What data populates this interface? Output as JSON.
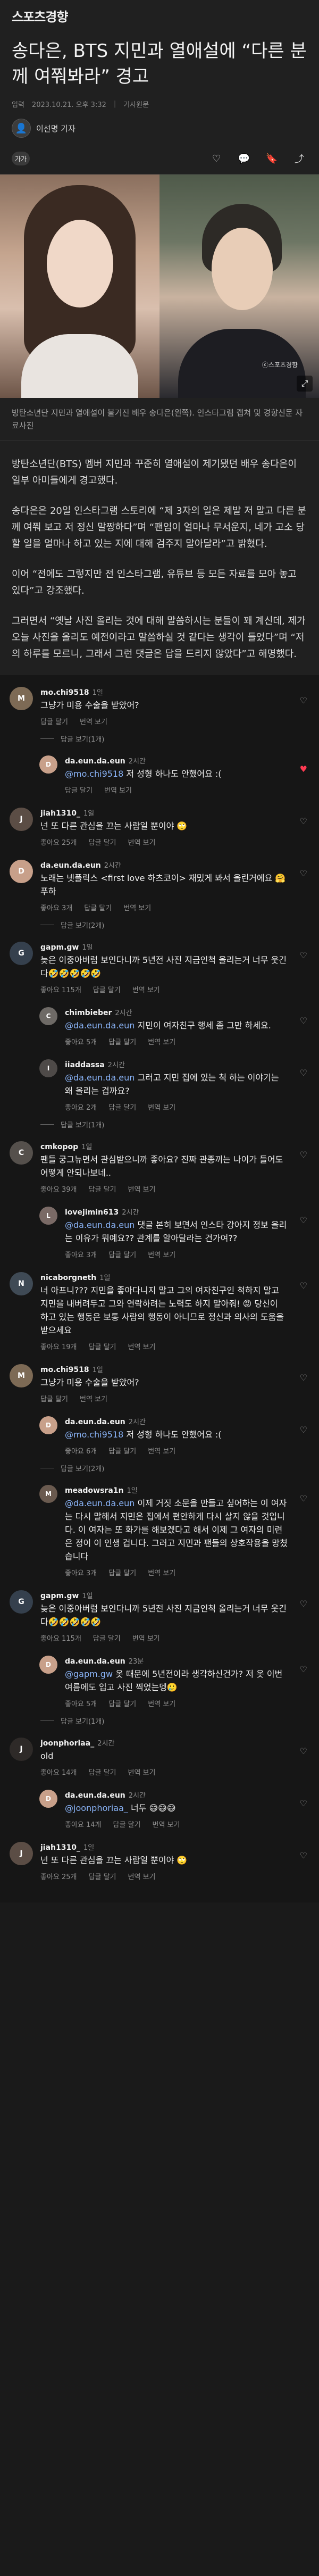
{
  "site": {
    "logo": "스포츠경향"
  },
  "article": {
    "headline": "송다은, BTS 지민과 열애설에 “다른 분께 여쭤봐라” 경고",
    "date_label": "입력",
    "date": "2023.10.21. 오후 3:32",
    "source_link": "기사원문",
    "reporter": "이선명 기자",
    "font_button": "가가",
    "photo_watermark": "ⓒ스포츠경향",
    "caption": "방탄소년단 지민과 열애설이 불거진 배우 송다은(왼쪽). 인스타그램 캡쳐 및 경향신문 자료사진",
    "paragraphs": [
      "방탄소년단(BTS) 멤버 지민과 꾸준히 열애설이 제기됐던 배우 송다은이 일부 아미들에게 경고했다.",
      "송다은은 20일 인스타그램 스토리에 “제 3자의 일은 제발 저 말고 다른 분께 여쭤 보고 저 정신 말짱하다”며 “팬임이 얼마나 무서운지, 네가 고소 당할 일을 얼마나 하고 있는 지에 대해 검주지 말아달라”고 밝혔다.",
      "이어 “전에도 그렇지만 전 인스타그램, 유튜브 등 모든 자료를 모아 놓고 있다”고 강조했다.",
      "그러면서 “옛날 사진 올리는 것에 대해 말씀하시는 분들이 꽤 계신데, 제가 오늘 사진을 올리도 예전이라고 말씀하실 것 같다는 생각이 들었다”며 “저의 하루를 모르니, 그래서 그런 댓글은 답을 드리지 않았다”고 해명했다."
    ]
  },
  "comments_ui": {
    "reply_label": "답글 달기",
    "see_translation": "번역 보기",
    "hide_replies": "답글 숨기기",
    "like_label": "좋아요"
  },
  "comments": [
    {
      "user": "mo.chi9518",
      "time": "1일",
      "text": "그냥가 미용 수술을 받았어?",
      "likes": "",
      "reply": false,
      "avatar_color": "#7d6a55",
      "initial": "M",
      "liked": false
    },
    {
      "user": "da.eun.da.eun",
      "time": "2시간",
      "mention": "@mo.chi9518",
      "text": " 저 성형 하나도 안했어요 :(",
      "likes": "",
      "reply": true,
      "avatar_color": "#c8a08a",
      "initial": "D",
      "liked": true
    },
    {
      "user": "jiah1310_",
      "time": "1일",
      "text": "넌 또 다른 관심을 끄는 사람일 뿐이야 🙄",
      "likes": "좋아요 25개",
      "reply": false,
      "avatar_color": "#5b4d45",
      "initial": "J",
      "liked": false
    },
    {
      "user": "da.eun.da.eun",
      "time": "2시간",
      "text": "노래는 넷플릭스 <first love 하츠코이> 재밌게 봐서 올린거에요 🤗 푸하",
      "likes": "좋아요 3개",
      "reply": false,
      "avatar_color": "#c8a08a",
      "initial": "D",
      "liked": false
    },
    {
      "user": "gapm.gw",
      "time": "1일",
      "text": "늦은 이중아버럼 보인다니까 5년전 사진 지금인척 올리는거 너무 웃긴다🤣🤣🤣🤣🤣",
      "likes": "좋아요 115개",
      "reply": false,
      "avatar_color": "#35404d",
      "initial": "G",
      "liked": false
    },
    {
      "user": "chimbieber",
      "time": "2시간",
      "mention": "@da.eun.da.eun",
      "text": " 지민이 여자친구 행세 좀 그만 하세요.",
      "likes": "좋아요 5개",
      "reply": true,
      "avatar_color": "#6e6a66",
      "initial": "C",
      "liked": false
    },
    {
      "user": "iiaddassa",
      "time": "2시간",
      "mention": "@da.eun.da.eun",
      "text": " 그러고 지민 집에 있는 척 하는 이야기는 왜 올리는 겁까요?",
      "likes": "좋아요 2개",
      "reply": true,
      "avatar_color": "#4e4a48",
      "initial": "I",
      "liked": false
    },
    {
      "user": "cmkopop",
      "time": "1일",
      "text": "팬들 궁그뉴면서 관심받으니까 좋아요? 진짜 관종끼는 나이가 들어도 어떻게 안되나보네..",
      "likes": "좋아요 39개",
      "reply": false,
      "avatar_color": "#55504c",
      "initial": "C",
      "liked": false
    },
    {
      "user": "lovejimin613",
      "time": "2시간",
      "mention": "@da.eun.da.eun",
      "text": " 댓글 본히 보면서 인스타 강아지 정보 올리는 이유가 뭐예요?? 관계를 알아달라는 건가여??",
      "likes": "좋아요 3개",
      "reply": true,
      "avatar_color": "#7a6a66",
      "initial": "L",
      "liked": false
    },
    {
      "user": "nicaborgneth",
      "time": "1일",
      "text": "너 아프니??? 지민을 좋아다니지 말고 그의 여자친구인 척하지 말고 지민을 내버려두고 그와 연락하려는 노력도 하지 말아줘! 😡 당신이 하고 있는 행동은 보통 사람의 행동이 아니므로 정신과 의사의 도움을 받으세요",
      "likes": "좋아요 19개",
      "reply": false,
      "avatar_color": "#3f4a55",
      "initial": "N",
      "liked": false
    },
    {
      "user": "mo.chi9518",
      "time": "1일",
      "text": "그냥가 미용 수술을 받았어?",
      "likes": "",
      "reply": false,
      "avatar_color": "#7d6a55",
      "initial": "M",
      "liked": false
    },
    {
      "user": "da.eun.da.eun",
      "time": "2시간",
      "mention": "@mo.chi9518",
      "text": " 저 성형 하나도 안했어요 :(",
      "likes": "좋아요 6개",
      "reply": true,
      "avatar_color": "#c8a08a",
      "initial": "D",
      "liked": false
    },
    {
      "user": "meadowsra1n",
      "time": "1일",
      "mention": "@da.eun.da.eun",
      "text": " 이제 거짓 소문을 만들고 싶어하는 이 여자는 다시 말해서 지민은 집에서 편안하게 다시 살지 않을 것입니다. 이 여자는 또 화가를 해보겠다고 해서 이제 그 여자의 미련은 정이 이 인생 겁니다. 그러고 지민과 팬들의 상호작용을 망쳤습니다",
      "likes": "좋아요 3개",
      "reply": true,
      "avatar_color": "#6a5a4f",
      "initial": "M",
      "liked": false
    },
    {
      "user": "gapm.gw",
      "time": "1일",
      "text": "늦은 이중아버럼 보인다니까 5년전 사진 지금인척 올리는거 너무 웃긴다🤣🤣🤣🤣🤣",
      "likes": "좋아요 115개",
      "reply": false,
      "avatar_color": "#35404d",
      "initial": "G",
      "liked": false
    },
    {
      "user": "da.eun.da.eun",
      "time": "23분",
      "mention": "@gapm.gw",
      "text": " 옷 때문에 5년전이라 생각하신건가? 저 옷 이번 여름에도 입고 사진 찍었는뎅🥲",
      "likes": "좋아요 5개",
      "reply": true,
      "avatar_color": "#c8a08a",
      "initial": "D",
      "liked": false
    },
    {
      "user": "joonphoriaa_",
      "time": "2시간",
      "text": "old",
      "likes": "좋아요 14개",
      "reply": false,
      "avatar_color": "#2e2a28",
      "initial": "J",
      "liked": false
    },
    {
      "user": "da.eun.da.eun",
      "time": "2시간",
      "mention": "@joonphoriaa_",
      "text": " 너두 😅😅😅",
      "likes": "좋아요 14개",
      "reply": true,
      "avatar_color": "#c8a08a",
      "initial": "D",
      "liked": false
    },
    {
      "user": "jiah1310_",
      "time": "1일",
      "text": "넌 또 다른 관심을 끄는 사람일 뿐이야 🙄",
      "likes": "좋아요 25개",
      "reply": false,
      "avatar_color": "#5b4d45",
      "initial": "J",
      "liked": false
    }
  ],
  "replies_toggle": [
    "답글 보기(1개)",
    "",
    "",
    "답글 보기(2개)",
    "",
    "",
    "답글 보기(1개)",
    "",
    "",
    "",
    "",
    "답글 보기(2개)",
    "",
    "",
    "답글 보기(1개)",
    "",
    ""
  ]
}
